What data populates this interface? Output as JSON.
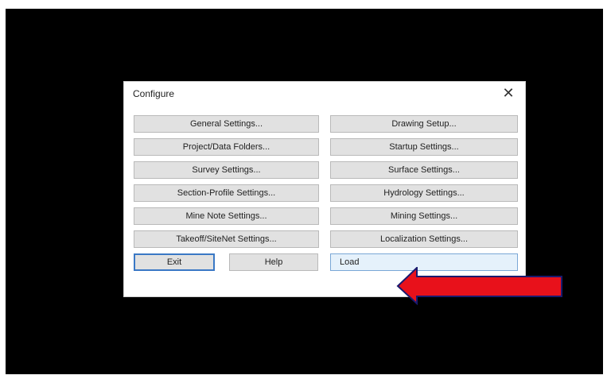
{
  "dialog": {
    "title": "Configure",
    "close_glyph": "✕",
    "buttons_left": [
      "General Settings...",
      "Project/Data Folders...",
      "Survey Settings...",
      "Section-Profile Settings...",
      "Mine Note Settings...",
      "Takeoff/SiteNet Settings..."
    ],
    "buttons_right": [
      "Drawing Setup...",
      "Startup Settings...",
      "Surface Settings...",
      "Hydrology Settings...",
      "Mining Settings...",
      "Localization Settings..."
    ],
    "exit_label": "Exit",
    "help_label": "Help",
    "load_label": "Load"
  },
  "annotation": {
    "arrow_color": "#e8111b",
    "arrow_icon": "red-arrow-pointing-left"
  }
}
